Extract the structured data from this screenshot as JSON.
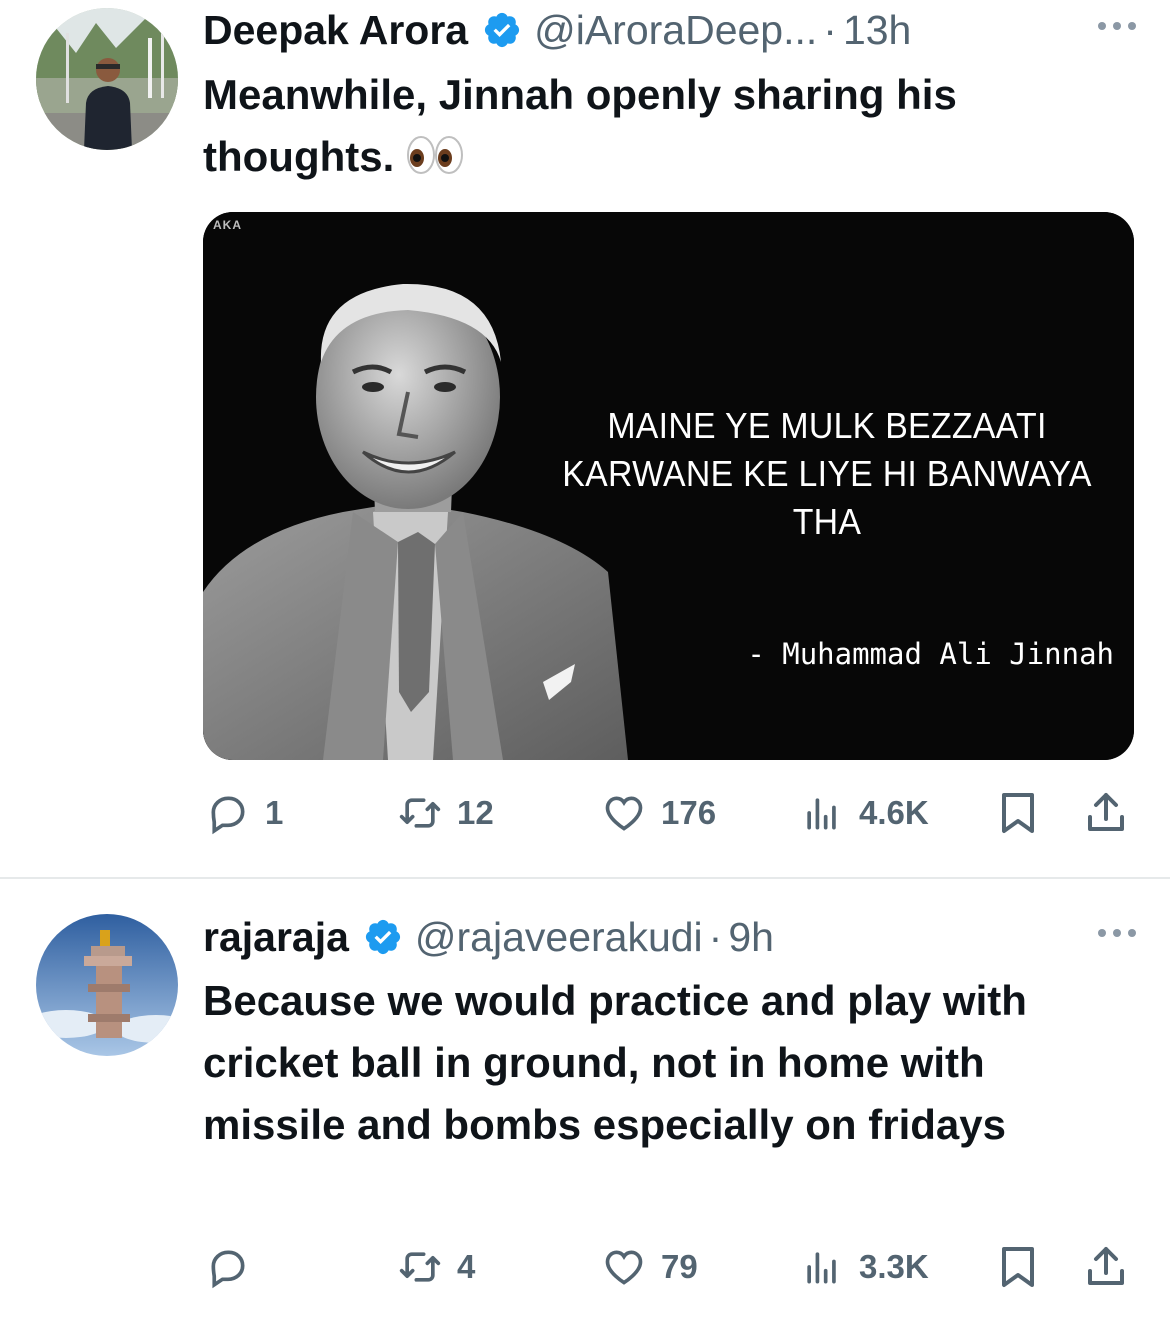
{
  "tweets": [
    {
      "name": "Deepak Arora",
      "handle": "@iAroraDeep...",
      "dot": "·",
      "time": "13h",
      "text": "Meanwhile, Jinnah openly sharing his thoughts.",
      "emoji_icon": "eyes-emoji",
      "media": {
        "watermark": "AKA",
        "quote": "MAINE YE MULK BEZZAATI KARWANE KE LIYE HI BANWAYA THA",
        "attribution": "- Muhammad Ali Jinnah"
      },
      "stats": {
        "replies": "1",
        "reposts": "12",
        "likes": "176",
        "views": "4.6K"
      }
    },
    {
      "name": "rajaraja",
      "handle": "@rajaveerakudi",
      "dot": "·",
      "time": "9h",
      "text": "Because we would practice and play with cricket ball in ground, not in home with missile and bombs especially on fridays",
      "stats": {
        "replies": "",
        "reposts": "4",
        "likes": "79",
        "views": "3.3K"
      }
    }
  ],
  "colors": {
    "text": "#0f1419",
    "secondary": "#536471",
    "verified": "#1d9bf0",
    "divider": "#e6e9ea"
  }
}
